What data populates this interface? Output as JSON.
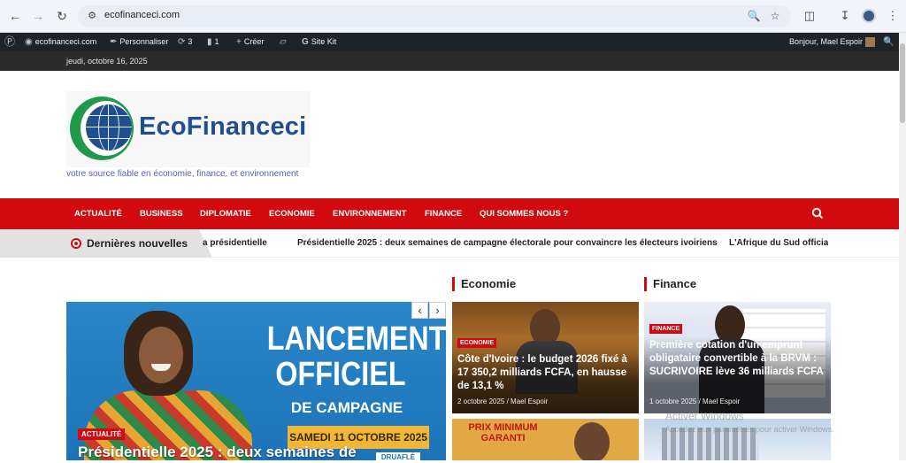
{
  "browser": {
    "url": "ecofinanceci.com"
  },
  "wpbar": {
    "site": "ecofinanceci.com",
    "customize": "Personnaliser",
    "updates": "3",
    "comments": "1",
    "create": "Créer",
    "sitekit": "Site Kit",
    "greeting": "Bonjour, Mael Espoir"
  },
  "date": "jeudi, octobre 16, 2025",
  "brand": {
    "name": "EcoFinanceci",
    "tagline": "votre source fiable en économie, finance, et environnement",
    "green": "#1e9a4a",
    "blue": "#1f4f8f"
  },
  "nav": [
    "ACTUALITÉ",
    "BUSINESS",
    "DIPLOMATIE",
    "ECONOMIE",
    "ENVIRONNEMENT",
    "FINANCE",
    "QUI SOMMES NOUS ?"
  ],
  "ticker": {
    "label": "Dernières nouvelles",
    "items": [
      "a présidentielle",
      "Présidentielle 2025 : deux semaines de campagne électorale pour convaincre les électeurs ivoiriens",
      "L'Afrique du Sud officiali"
    ]
  },
  "hero": {
    "poster_line1": "LANCEMENT",
    "poster_line2": "OFFICIEL",
    "poster_line3": "DE CAMPAGNE",
    "poster_date": "SAMEDI 11 OCTOBRE 2025",
    "badge": "ACTUALITÉ",
    "title": "Présidentielle 2025 : deux semaines de",
    "corner": "DRUAFLÉ"
  },
  "sections": {
    "economie": "Economie",
    "finance": "Finance"
  },
  "eco_card": {
    "badge": "ECONOMIE",
    "title": "Côte d'Ivoire : le budget 2026 fixé à 17 350,2 milliards FCFA, en hausse de 13,1 %",
    "meta": "2 octobre 2025 / Mael Espoir"
  },
  "fin_card": {
    "badge": "FINANCE",
    "title": "Première cotation d'un emprunt obligataire convertible à la BRVM : SUCRIVOIRE lève 36 milliards FCFA",
    "meta": "1 octobre 2025 / Mael Espoir"
  },
  "eco_card2": {
    "text": "PRIX MINIMUM GARANTI"
  },
  "windows": {
    "line1": "Activer Windows",
    "line2": "Accédez aux paramètres pour activer Windows."
  },
  "accent": "#d10a10"
}
